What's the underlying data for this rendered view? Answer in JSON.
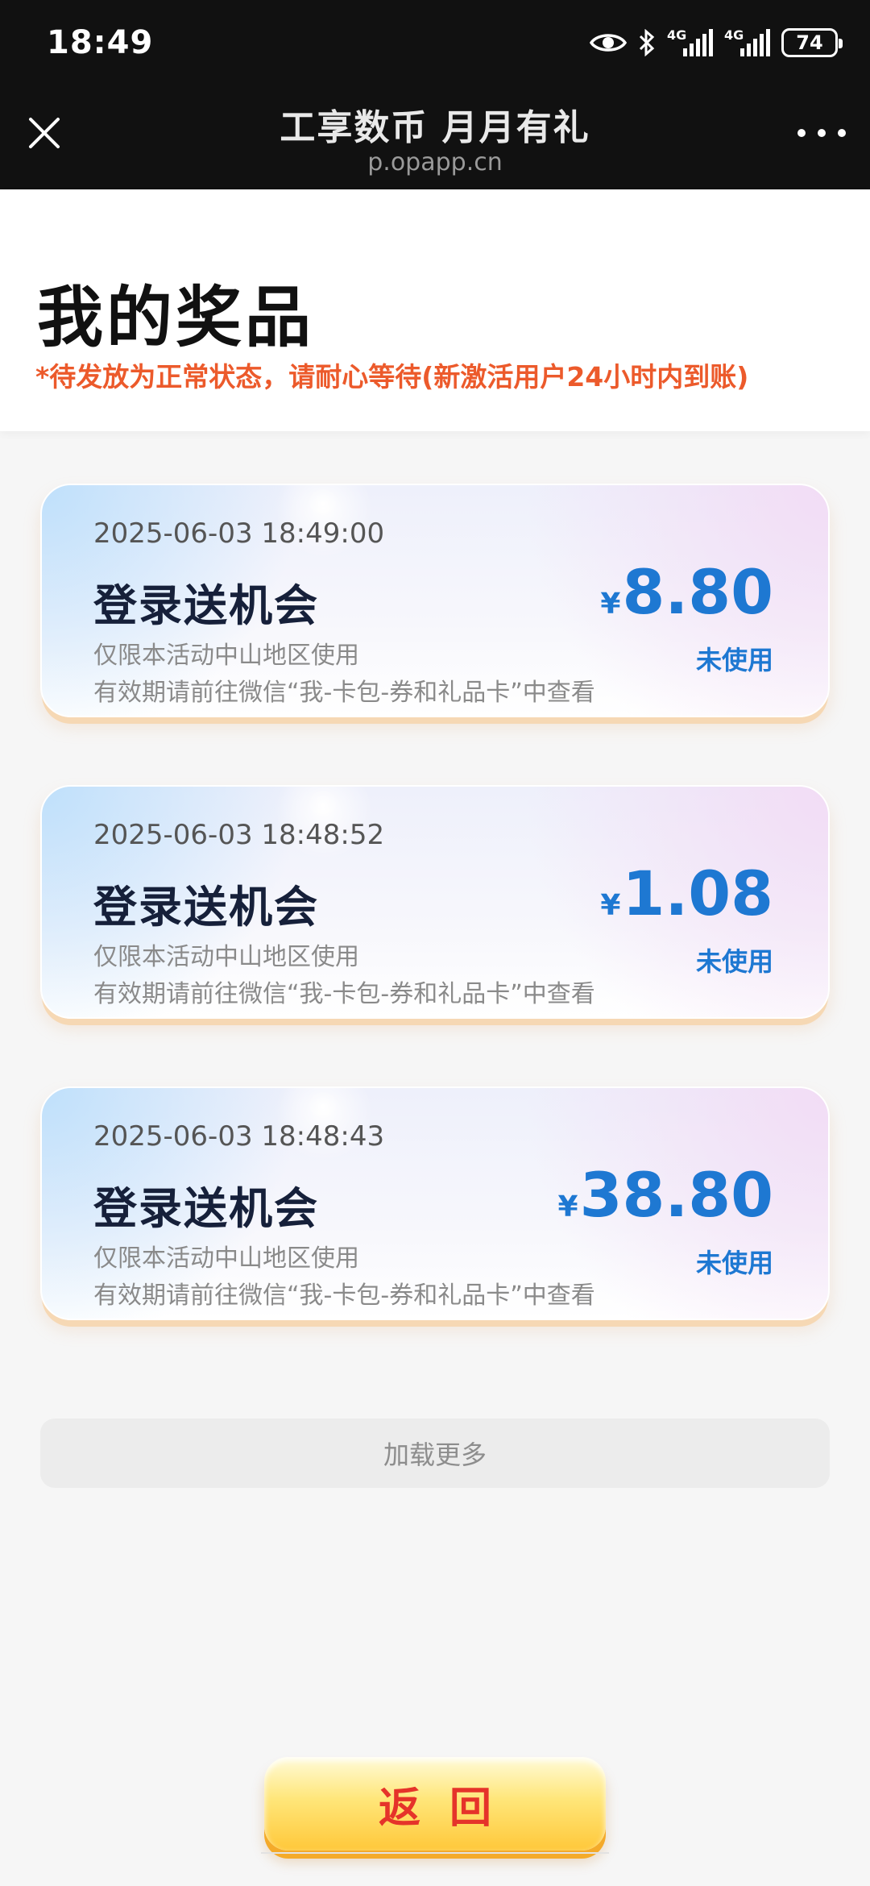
{
  "status_bar": {
    "time": "18:49",
    "network_1": "4G",
    "network_2": "4G",
    "battery": "74"
  },
  "nav": {
    "title": "工享数币 月月有礼",
    "subtitle": "p.opapp.cn"
  },
  "header": {
    "title": "我的奖品",
    "notice": "*待发放为正常状态，请耐心等待(新激活用户24小时内到账)"
  },
  "prizes": [
    {
      "date": "2025-06-03 18:49:00",
      "name": "登录送机会",
      "currency": "¥",
      "amount": "8.80",
      "status": "未使用",
      "scope": "仅限本活动中山地区使用",
      "validity": "有效期请前往微信“我-卡包-券和礼品卡”中查看"
    },
    {
      "date": "2025-06-03 18:48:52",
      "name": "登录送机会",
      "currency": "¥",
      "amount": "1.08",
      "status": "未使用",
      "scope": "仅限本活动中山地区使用",
      "validity": "有效期请前往微信“我-卡包-券和礼品卡”中查看"
    },
    {
      "date": "2025-06-03 18:48:43",
      "name": "登录送机会",
      "currency": "¥",
      "amount": "38.80",
      "status": "未使用",
      "scope": "仅限本活动中山地区使用",
      "validity": "有效期请前往微信“我-卡包-券和礼品卡”中查看"
    }
  ],
  "load_more": "加载更多",
  "back_button": "返回",
  "colors": {
    "accent_blue": "#1e78d2",
    "notice_orange": "#ec5a2b",
    "back_text_red": "#e5332a",
    "back_button_yellow": "#ffd54a"
  },
  "icons": {
    "close": "close-icon",
    "more": "more-icon",
    "eye": "eye-icon",
    "bluetooth": "bluetooth-icon"
  }
}
